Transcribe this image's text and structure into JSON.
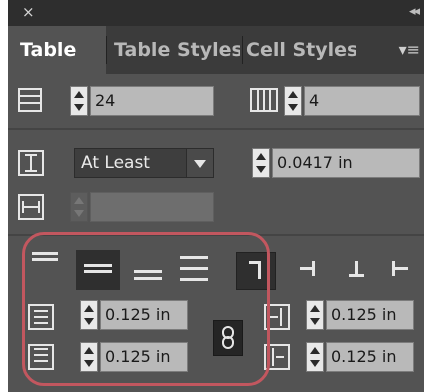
{
  "titlebar": {
    "close_glyph": "×",
    "collapse_glyph": "◂◂"
  },
  "tabs": [
    {
      "label": "Table",
      "active": true
    },
    {
      "label": "Table Styles",
      "active": false
    },
    {
      "label": "Cell Styles",
      "active": false
    }
  ],
  "menu_glyph": "▾≡",
  "rows_field": {
    "value": "24"
  },
  "columns_field": {
    "value": "4"
  },
  "row_height": {
    "mode": "At Least",
    "value": "0.0417 in"
  },
  "column_width": {
    "value": ""
  },
  "insets": {
    "top": "0.125 in",
    "bottom": "0.125 in",
    "left": "0.125 in",
    "right": "0.125 in"
  },
  "colors": {
    "panel": "#535353",
    "highlight": "#c2575f",
    "field": "#b9b9b9"
  },
  "icons": {
    "rows": "table-rows-icon",
    "columns": "table-columns-icon",
    "row_height": "row-height-icon",
    "column_width": "column-width-icon",
    "align_top": "align-top-icon",
    "align_center": "align-center-icon",
    "align_bottom": "align-bottom-icon",
    "justify": "justify-vertical-icon",
    "link": "link-icon"
  }
}
